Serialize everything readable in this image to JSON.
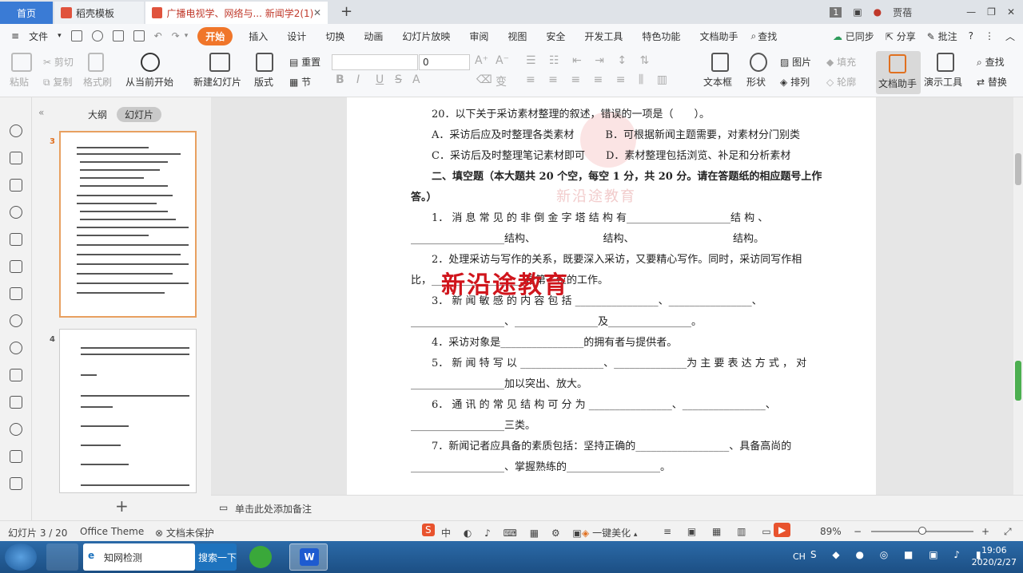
{
  "tabs": {
    "home": "首页",
    "template": "稻壳模板",
    "doc": "广播电视学、网络与... 新闻学2(1)P",
    "badge": "1",
    "user": "贾蓓"
  },
  "menu": {
    "file": "文件",
    "items": [
      "开始",
      "插入",
      "设计",
      "切换",
      "动画",
      "幻灯片放映",
      "审阅",
      "视图",
      "安全",
      "开发工具",
      "特色功能",
      "文档助手"
    ],
    "search": "查找",
    "synced": "已同步",
    "share": "分享",
    "comment": "批注",
    "help": "?"
  },
  "ribbon": {
    "paste": "粘贴",
    "cut": "剪切",
    "copy": "复制",
    "format_painter": "格式刷",
    "from_current": "从当前开始",
    "new_slide": "新建幻灯片",
    "layout": "版式",
    "reset": "重置",
    "section": "节",
    "font_size": "0",
    "textbox": "文本框",
    "shape": "形状",
    "picture": "图片",
    "fill": "填充",
    "arrange": "排列",
    "outline": "轮廓",
    "doc_assistant": "文档助手",
    "presenter": "演示工具",
    "find": "查找",
    "replace": "替换",
    "format_buttons": [
      "B",
      "I",
      "U",
      "S",
      "A"
    ],
    "wen": "变"
  },
  "sidebar": {
    "outline_tab": "大纲",
    "slides_tab": "幻灯片",
    "slide3_num": "3",
    "slide4_num": "4",
    "add_button": "+"
  },
  "slide": {
    "lines": [
      "20．以下关于采访素材整理的叙述，错误的一项是（　　）。",
      "A．采访后应及时整理各类素材　　　B．可根据新闻主题需要，对素材分门别类",
      "C．采访后及时整理笔记素材即可　　D．素材整理包括浏览、补足和分析素材",
      "二、填空题（本大题共 20 个空，每空 1 分，共 20 分。请在答题纸的相应题号上作",
      "答。）",
      "1． 消 息 常 见 的 非 倒 金 字 塔 结 构 有____________________结 构 、",
      "__________________结构、　　　　　　　结构、　　　　　　　　　　结构。",
      "2．处理采访与写作的关系，既要深入采访，又要精心写作。同时，采访同写作相",
      "比，__________________是第一位的工作。",
      "3． 新 闻 敏 感 的 内 容 包 括 ________________、________________、",
      "__________________、________________及________________。",
      "4．采访对象是________________的拥有者与提供者。",
      "5． 新 闻 特 写 以 ________________、______________为 主 要 表 达 方 式 ， 对",
      "__________________加以突出、放大。",
      "6． 通 讯 的 常 见 结 构 可 分 为 ________________、________________、",
      "__________________三类。",
      "7．新闻记者应具备的素质包括：坚持正确的__________________、具备高尚的",
      "__________________、掌握熟练的__________________。"
    ],
    "watermark": "新沿途教育",
    "watermark_red": "新沿途教育"
  },
  "notes": {
    "placeholder": "单击此处添加备注"
  },
  "status": {
    "slide_counter": "幻灯片 3 / 20",
    "theme": "Office Theme",
    "protect": "文档未保护",
    "beautify": "一键美化",
    "zoom": "89%",
    "zoom_level": 0.5
  },
  "taskbar": {
    "search_app": "知网检测",
    "search_btn": "搜索一下",
    "lang": "CH",
    "time": "19:06",
    "date": "2020/2/27"
  },
  "colors": {
    "accent": "#f0762a",
    "home_tab": "#3a7bd5",
    "watermark_red": "#d0151c"
  }
}
